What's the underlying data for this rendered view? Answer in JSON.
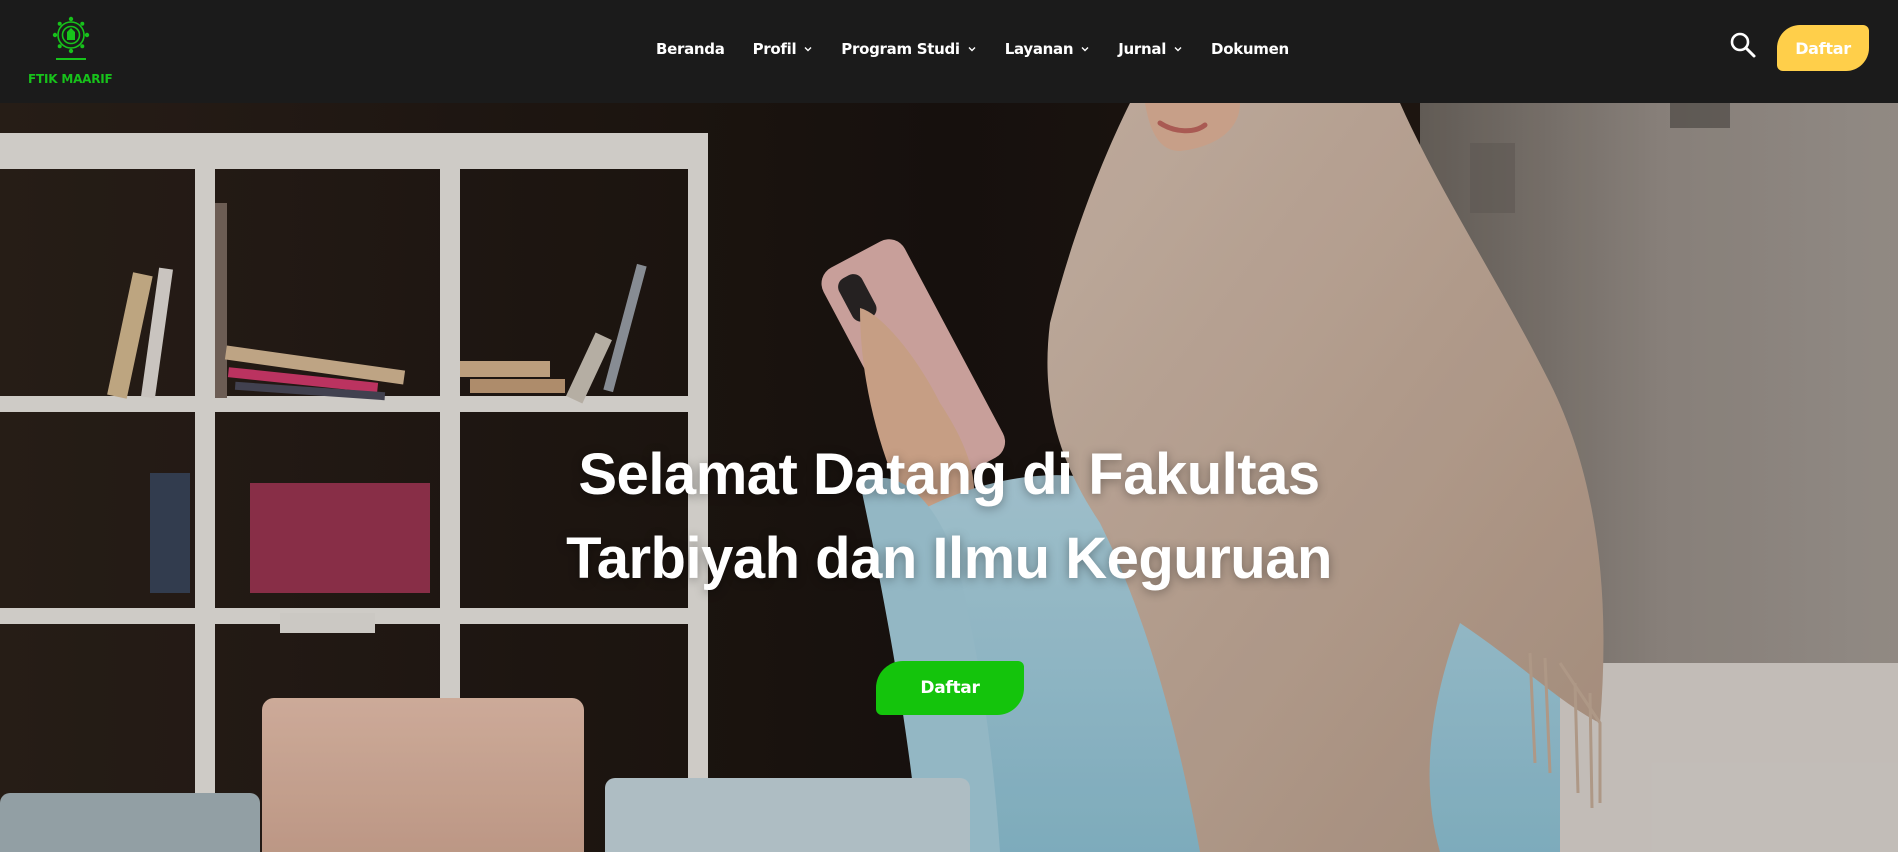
{
  "brand": {
    "name": "FTIK MAARIF",
    "logo_color": "#17c21b"
  },
  "nav": {
    "items": [
      {
        "label": "Beranda",
        "has_dropdown": false
      },
      {
        "label": "Profil",
        "has_dropdown": true
      },
      {
        "label": "Program Studi",
        "has_dropdown": true
      },
      {
        "label": "Layanan",
        "has_dropdown": true
      },
      {
        "label": "Jurnal",
        "has_dropdown": true
      },
      {
        "label": "Dokumen",
        "has_dropdown": false
      }
    ]
  },
  "header": {
    "search_icon": "search-icon",
    "cta_label": "Daftar",
    "cta_color": "#ffcf4a",
    "background": "#1b1b1b"
  },
  "hero": {
    "title_line1": "Selamat Datang di Fakultas",
    "title_line2": "Tarbiyah dan Ilmu Keguruan",
    "cta_label": "Daftar",
    "cta_color": "#14c40c"
  }
}
